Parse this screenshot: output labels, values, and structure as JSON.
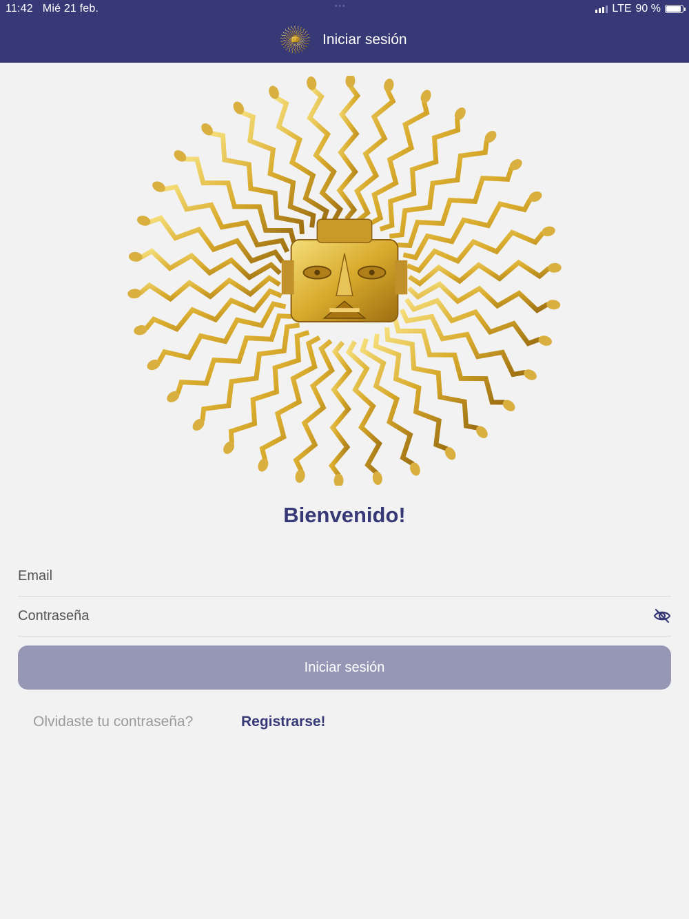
{
  "status_bar": {
    "time": "11:42",
    "date": "Mié 21 feb.",
    "dots": "•••",
    "network": "LTE",
    "battery": "90 %",
    "battery_level": 0.9
  },
  "nav": {
    "title": "Iniciar sesión",
    "logo_icon": "golden-sun-mask-icon",
    "bar_color": "#363976"
  },
  "hero": {
    "image": "golden-sun-mask-image"
  },
  "welcome": "Bienvenido!",
  "form": {
    "email_placeholder": "Email",
    "password_placeholder": "Contraseña",
    "password_toggle_icon": "eye-slash-icon",
    "submit_label": "Iniciar sesión"
  },
  "links": {
    "forgot": "Olvidaste tu contraseña?",
    "register": "Registrarse!"
  },
  "colors": {
    "primary": "#363976",
    "button_disabled": "#9597b5",
    "background": "#f2f2f2",
    "gold": "#d8aa2c"
  }
}
